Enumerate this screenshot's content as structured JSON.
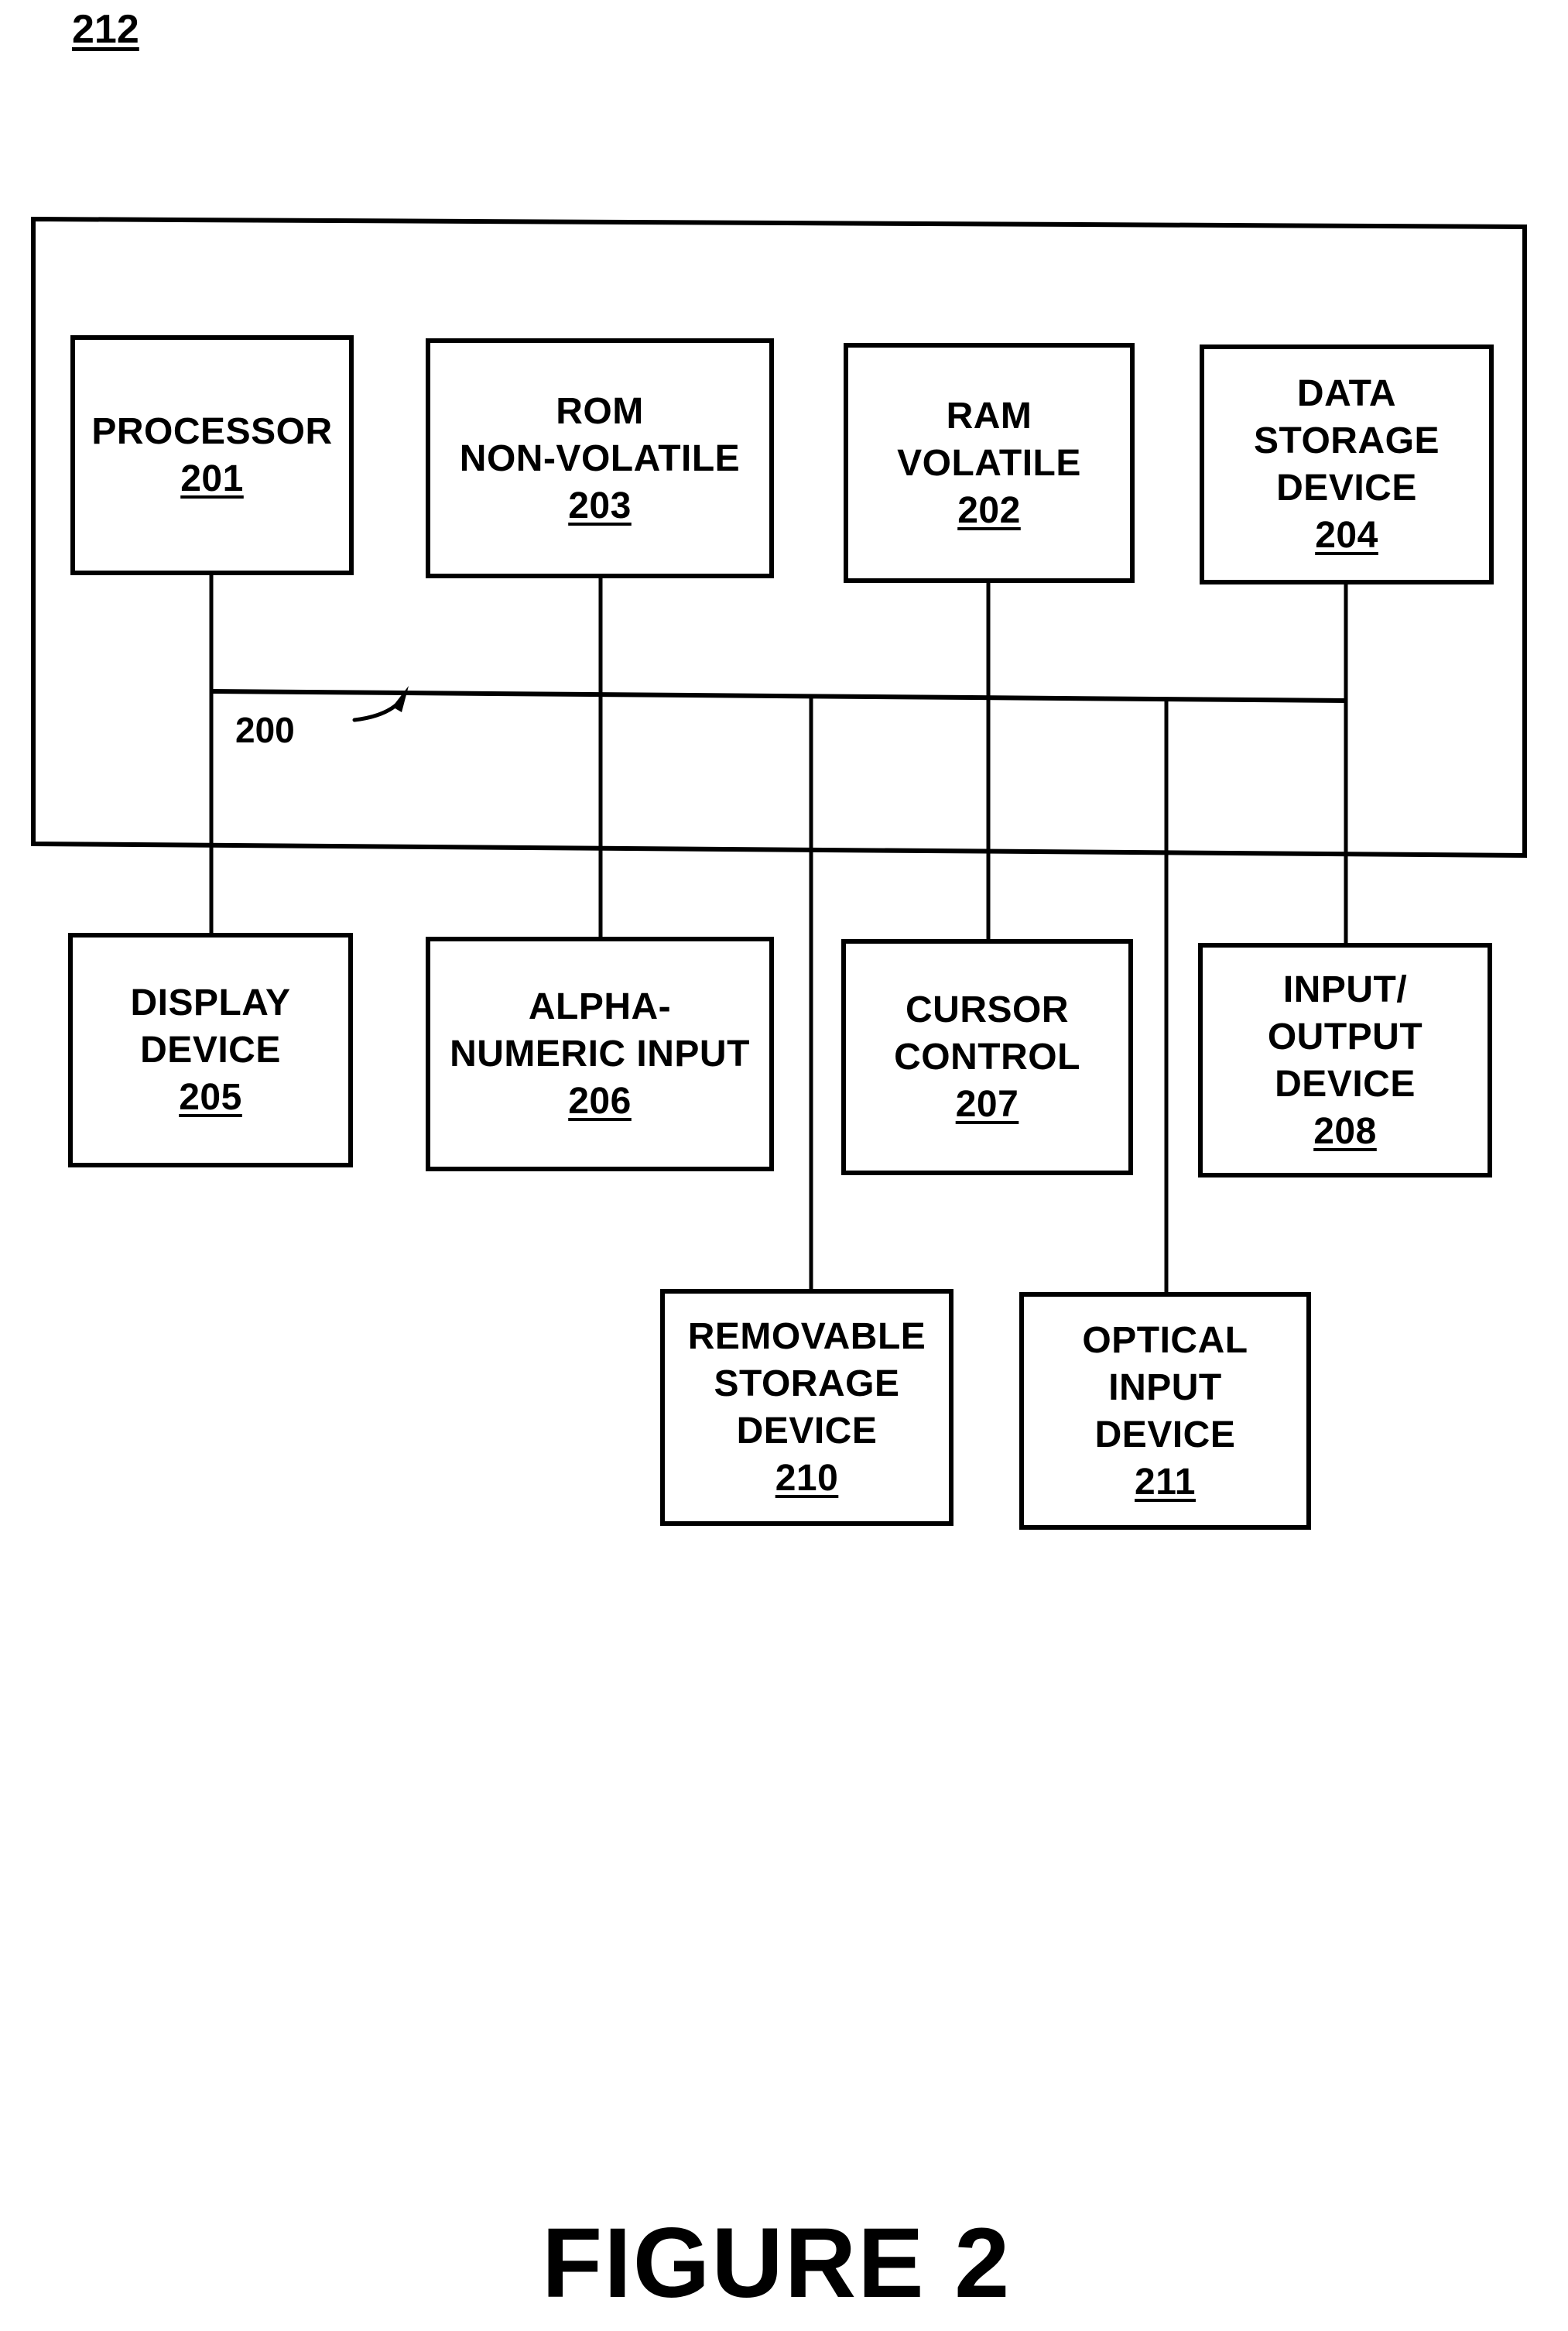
{
  "sheet_reference": "212",
  "bus": {
    "label": "200"
  },
  "components": {
    "processor": {
      "lines": [
        "PROCESSOR"
      ],
      "ref": "201"
    },
    "rom": {
      "lines": [
        "ROM",
        "NON-VOLATILE"
      ],
      "ref": "203"
    },
    "ram": {
      "lines": [
        "RAM",
        "VOLATILE"
      ],
      "ref": "202"
    },
    "data_storage": {
      "lines": [
        "DATA",
        "STORAGE",
        "DEVICE"
      ],
      "ref": "204"
    },
    "display": {
      "lines": [
        "DISPLAY",
        "DEVICE"
      ],
      "ref": "205"
    },
    "alphanumeric": {
      "lines": [
        "ALPHA-",
        "NUMERIC INPUT"
      ],
      "ref": "206"
    },
    "cursor": {
      "lines": [
        "CURSOR",
        "CONTROL"
      ],
      "ref": "207"
    },
    "io": {
      "lines": [
        "INPUT/",
        "OUTPUT",
        "DEVICE"
      ],
      "ref": "208"
    },
    "removable": {
      "lines": [
        "REMOVABLE",
        "STORAGE",
        "DEVICE"
      ],
      "ref": "210"
    },
    "optical": {
      "lines": [
        "OPTICAL",
        "INPUT",
        "DEVICE"
      ],
      "ref": "211"
    }
  },
  "caption": "FIGURE 2"
}
